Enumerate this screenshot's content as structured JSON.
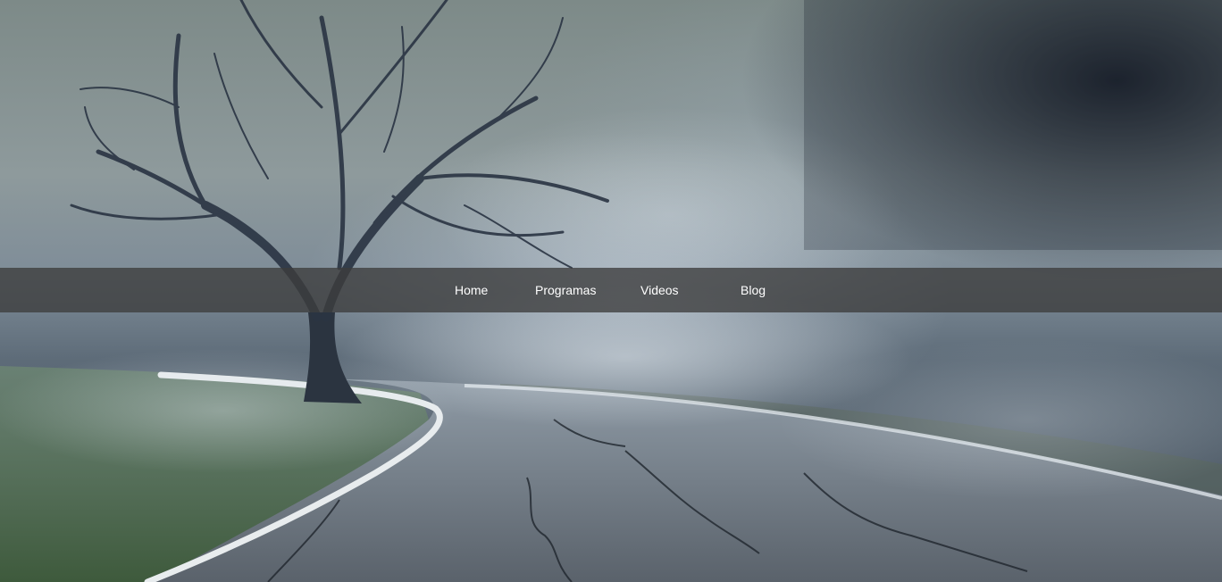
{
  "nav": {
    "items": [
      {
        "label": "Home"
      },
      {
        "label": "Programas"
      },
      {
        "label": "Videos"
      },
      {
        "label": "Blog"
      }
    ]
  },
  "hero": {
    "background": "foggy-road-with-bare-tree",
    "colors": {
      "sky": "#8e9a9c",
      "dark_clouds": "#0f1420",
      "grass": "#4f6a4a",
      "asphalt": "#5d6670",
      "road_line": "#e8ecee",
      "navbar": "#3c3c3c"
    }
  }
}
